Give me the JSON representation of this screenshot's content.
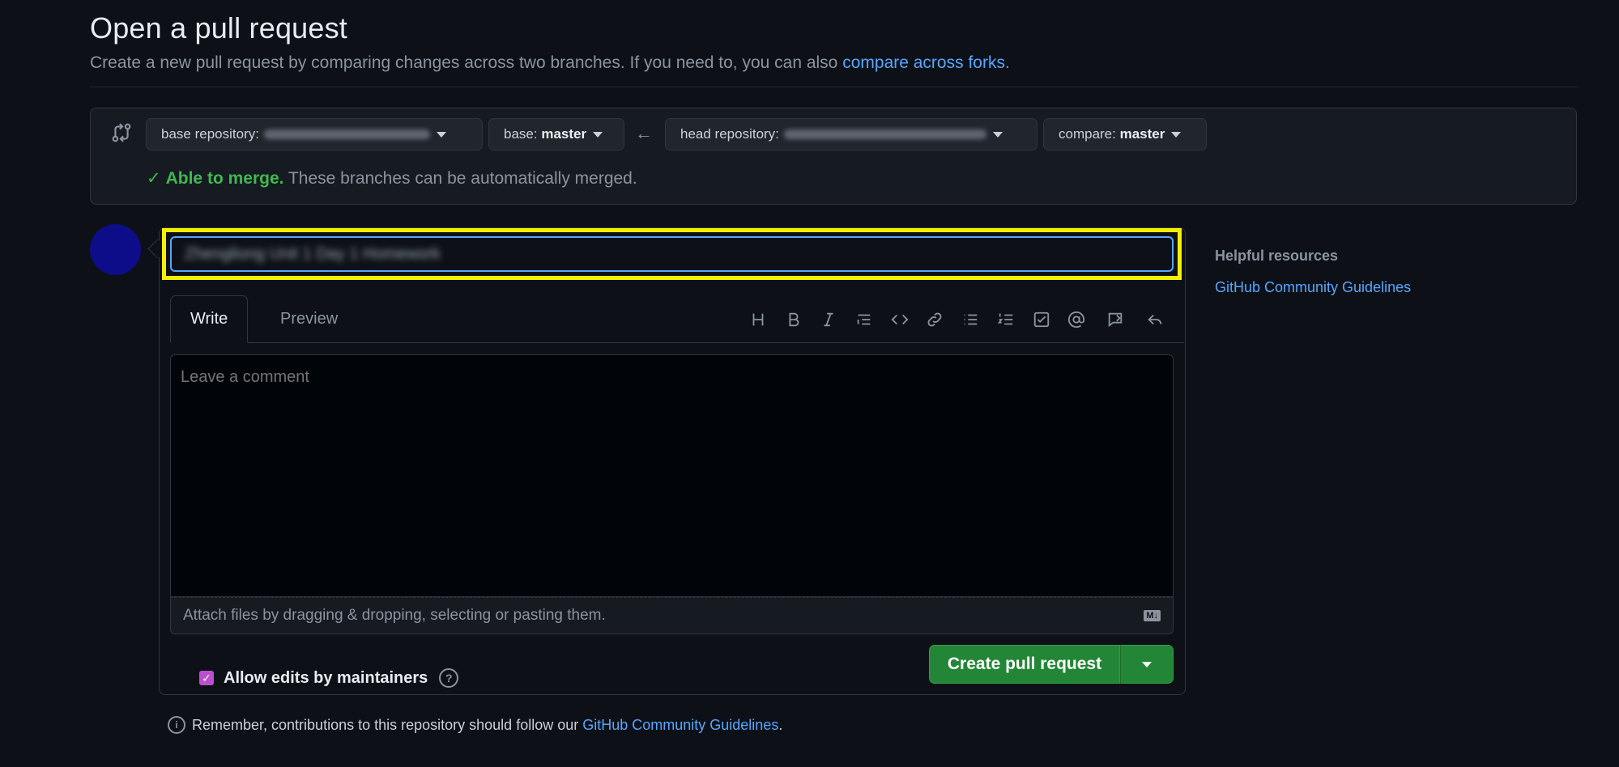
{
  "page": {
    "title": "Open a pull request",
    "subtitle": "Create a new pull request by comparing changes across two branches. If you need to, you can also",
    "subtitle_link": "compare across forks",
    "subtitle_end": "."
  },
  "compare": {
    "base_repo_label": "base repository:",
    "base_label": "base:",
    "base_value": "master",
    "head_repo_label": "head repository:",
    "compare_label": "compare:",
    "compare_value": "master",
    "merge_status": "Able to merge.",
    "merge_detail": "These branches can be automatically merged."
  },
  "form": {
    "title_value_blurred": "Zhengliong Unit 1 Day 1 Homework",
    "tab_write": "Write",
    "tab_preview": "Preview",
    "comment_placeholder": "Leave a comment",
    "attach_text": "Attach files by dragging & dropping, selecting or pasting them.",
    "md_badge": "M↓",
    "allow_edits": "Allow edits by maintainers",
    "create_button": "Create pull request"
  },
  "footer": {
    "remember_text": "Remember, contributions to this repository should follow our",
    "remember_link": "GitHub Community Guidelines",
    "remember_end": "."
  },
  "sidebar": {
    "heading": "Helpful resources",
    "link": "GitHub Community Guidelines"
  },
  "toolbar_icons": [
    "heading-icon",
    "bold-icon",
    "italic-icon",
    "quote-icon",
    "code-icon",
    "link-icon",
    "bullet-list-icon",
    "numbered-list-icon",
    "task-list-icon",
    "mention-icon",
    "reference-icon",
    "reply-icon"
  ]
}
